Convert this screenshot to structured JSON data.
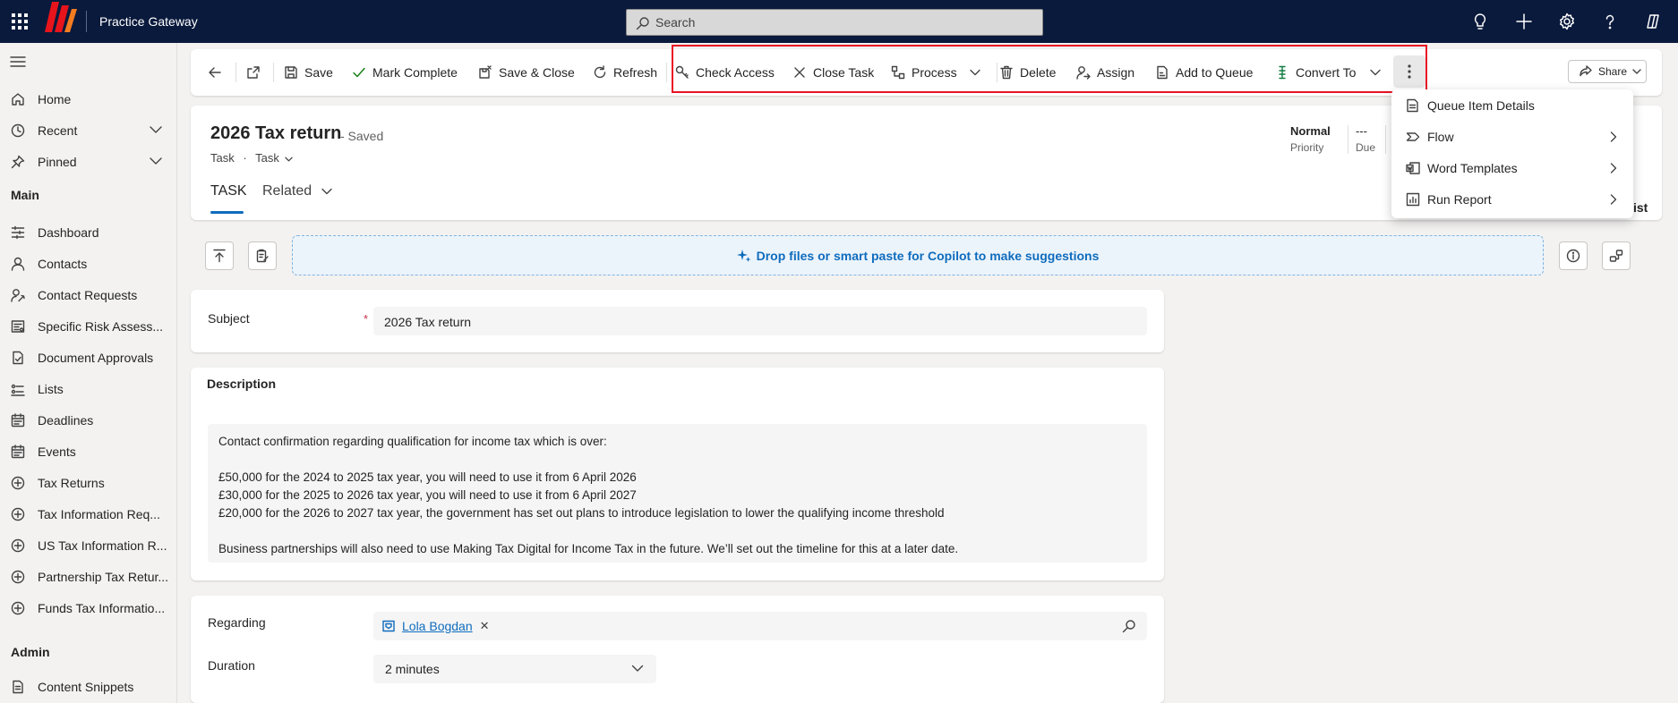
{
  "app": {
    "title": "Practice Gateway"
  },
  "search": {
    "placeholder": "Search"
  },
  "topbar_icons": [
    "lightbulb-icon",
    "plus-icon",
    "gear-icon",
    "help-icon",
    "copilot-icon"
  ],
  "sidebar": {
    "top_items": [
      {
        "label": "Home",
        "icon": "home-icon"
      },
      {
        "label": "Recent",
        "icon": "clock-icon"
      },
      {
        "label": "Pinned",
        "icon": "pin-icon"
      }
    ],
    "sections": [
      {
        "title": "Main",
        "items": [
          {
            "label": "Dashboard",
            "icon": "dashboard-icon"
          },
          {
            "label": "Contacts",
            "icon": "person-icon"
          },
          {
            "label": "Contact Requests",
            "icon": "person-request-icon"
          },
          {
            "label": "Specific Risk Assess...",
            "icon": "risk-icon"
          },
          {
            "label": "Document Approvals",
            "icon": "document-approval-icon"
          },
          {
            "label": "Lists",
            "icon": "list-icon"
          },
          {
            "label": "Deadlines",
            "icon": "calendar-icon"
          },
          {
            "label": "Events",
            "icon": "calendar-icon"
          },
          {
            "label": "Tax Returns",
            "icon": "tax-icon"
          },
          {
            "label": "Tax Information Req...",
            "icon": "tax-icon"
          },
          {
            "label": "US Tax Information R...",
            "icon": "tax-icon"
          },
          {
            "label": "Partnership Tax Retur...",
            "icon": "tax-icon"
          },
          {
            "label": "Funds Tax Informatio...",
            "icon": "tax-icon"
          }
        ]
      },
      {
        "title": "Admin",
        "items": [
          {
            "label": "Content Snippets",
            "icon": "snippet-icon"
          }
        ]
      }
    ]
  },
  "commands": {
    "save": "Save",
    "mark_complete": "Mark Complete",
    "save_close": "Save & Close",
    "refresh": "Refresh",
    "check_access": "Check Access",
    "close_task": "Close Task",
    "process": "Process",
    "delete": "Delete",
    "assign": "Assign",
    "add_to_queue": "Add to Queue",
    "convert_to": "Convert To",
    "share": "Share"
  },
  "overflow_menu": [
    {
      "label": "Queue Item Details",
      "has_submenu": false
    },
    {
      "label": "Flow",
      "has_submenu": true
    },
    {
      "label": "Word Templates",
      "has_submenu": true
    },
    {
      "label": "Run Report",
      "has_submenu": true
    }
  ],
  "record": {
    "title": "2026 Tax return",
    "status": "- Saved",
    "entity": "Task",
    "separator": "·",
    "form": "Task",
    "header_fields": [
      {
        "value": "Normal",
        "label": "Priority"
      },
      {
        "value": "---",
        "label": "Due"
      }
    ],
    "peek_text": "ist"
  },
  "tabs": [
    {
      "label": "TASK",
      "active": true
    },
    {
      "label": "Related",
      "active": false
    }
  ],
  "copilot": {
    "drop_text": "Drop files or smart paste for Copilot to make suggestions"
  },
  "form": {
    "subject_label": "Subject",
    "subject_value": "2026 Tax return",
    "description_label": "Description",
    "description_lines": [
      "Contact confirmation regarding qualification for income tax which is over:",
      "",
      "£50,000 for the 2024 to 2025 tax year, you will need to use it from 6 April 2026",
      "£30,000 for the 2025 to 2026 tax year, you will need to use it from 6 April 2027",
      "£20,000 for the 2026 to 2027 tax year, the government has set out plans to introduce legislation to lower the qualifying income threshold",
      "",
      "Business partnerships will also need to use Making Tax Digital for Income Tax in the future. We’ll set out the timeline for this at a later date."
    ],
    "regarding_label": "Regarding",
    "regarding_value": "Lola Bogdan",
    "duration_label": "Duration",
    "duration_value": "2 minutes"
  },
  "colors": {
    "topbar": "#0a1a3c",
    "accent": "#0f6cbd",
    "highlight": "#e81123",
    "required": "#c4314b",
    "logo_red": "#e8141c",
    "logo_orange": "#f47b20"
  }
}
